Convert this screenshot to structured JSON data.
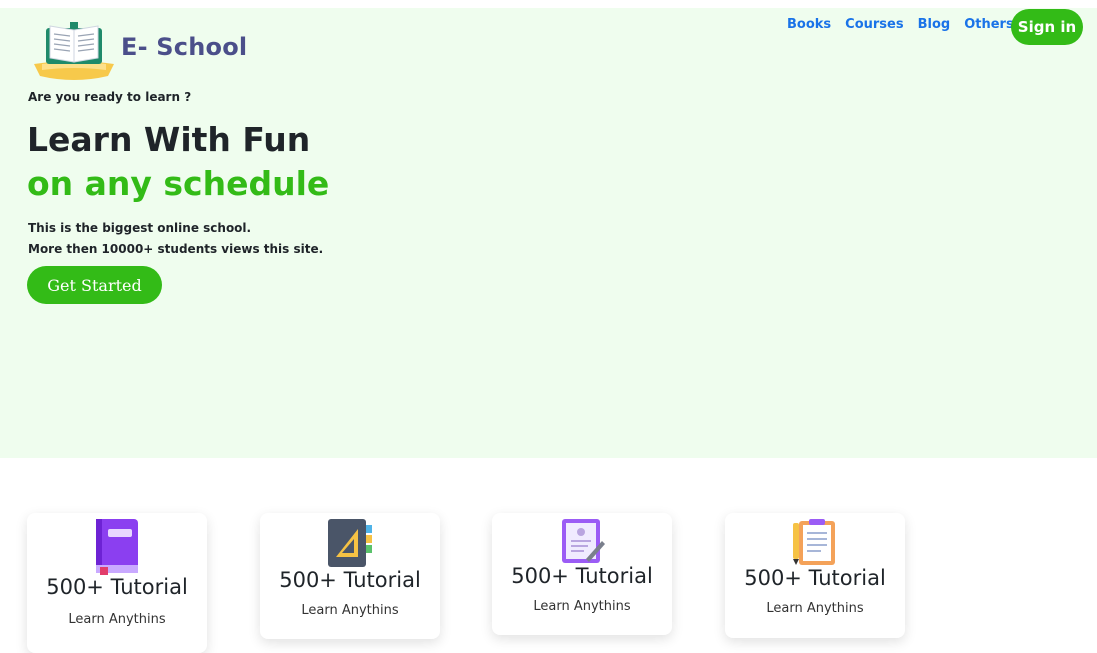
{
  "brand": {
    "name": "E- School"
  },
  "nav": {
    "items": [
      "Books",
      "Courses",
      "Blog",
      "Others"
    ],
    "signin": "Sign in"
  },
  "hero": {
    "eyebrow": "Are you ready to learn ?",
    "title_line1": "Learn With Fun",
    "title_line2": "on any schedule",
    "desc_line1": "This is the biggest online school.",
    "desc_line2": "More then 10000+ students views this site.",
    "cta": "Get Started"
  },
  "cards": [
    {
      "icon": "purple-book-icon",
      "title": "500+ Tutorial",
      "sub": "Learn Anythins"
    },
    {
      "icon": "notebook-ruler-icon",
      "title": "500+ Tutorial",
      "sub": "Learn Anythins"
    },
    {
      "icon": "document-pen-icon",
      "title": "500+ Tutorial",
      "sub": "Learn Anythins"
    },
    {
      "icon": "clipboard-pen-icon",
      "title": "500+ Tutorial",
      "sub": "Learn Anythins"
    }
  ],
  "colors": {
    "accent": "#33bb17",
    "link": "#1a73e8",
    "brand": "#4b4f8a",
    "hero_bg": "#effdee"
  }
}
